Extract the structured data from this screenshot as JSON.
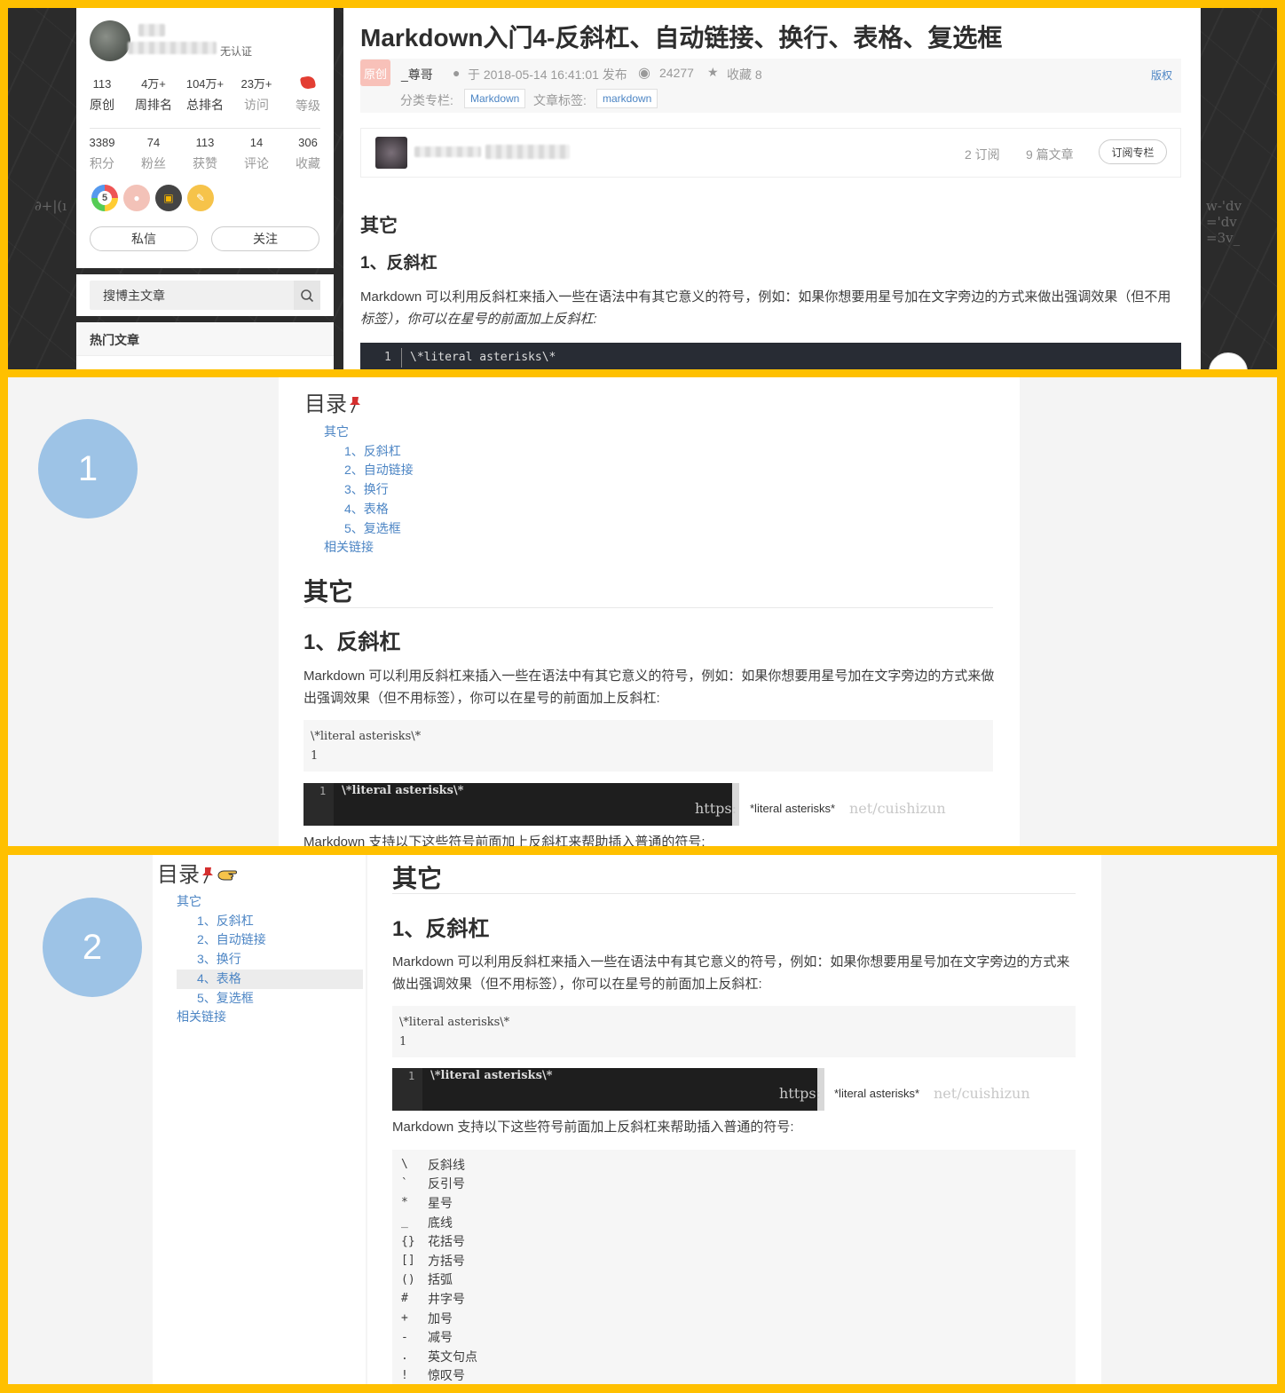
{
  "panel1": {
    "profile": {
      "auth": "无认证",
      "stats_top": [
        {
          "value": "113",
          "label": "原创"
        },
        {
          "value": "4万+",
          "label": "周排名"
        },
        {
          "value": "104万+",
          "label": "总排名"
        },
        {
          "value": "23万+",
          "label": "访问"
        },
        {
          "value": "",
          "label": "等级"
        }
      ],
      "stats_bottom": [
        {
          "value": "3389",
          "label": "积分"
        },
        {
          "value": "74",
          "label": "粉丝"
        },
        {
          "value": "113",
          "label": "获赞"
        },
        {
          "value": "14",
          "label": "评论"
        },
        {
          "value": "306",
          "label": "收藏"
        }
      ],
      "badge_five": "5",
      "message_button": "私信",
      "follow_button": "关注"
    },
    "search": {
      "placeholder": "搜博主文章"
    },
    "hot": {
      "title": "热门文章"
    },
    "article": {
      "title": "Markdown入门4-反斜杠、自动链接、换行、表格、复选框",
      "original_badge": "原创",
      "author": "_尊哥",
      "published": "于 2018-05-14 16:41:01 发布",
      "views": "24277",
      "favorites": "收藏 8",
      "copyright": "版权",
      "category_label": "分类专栏:",
      "category": "Markdown",
      "tags_label": "文章标签:",
      "tag": "markdown",
      "subscriptions": "2 订阅",
      "articles_count": "9 篇文章",
      "subscribe_button": "订阅专栏",
      "h2": "其它",
      "h3": "1、反斜杠",
      "para_before": "Markdown 可以利用反斜杠来插入一些在语法中有其它意义的符号，例如：如果你想要用星号加在文字旁边的方式来做出强调效果（但不用",
      "para_italic": "标签），你可以在星号的前面加上反斜杠:",
      "code_line_no": "1",
      "code_text": "\\*literal asterisks\\*"
    }
  },
  "panel2": {
    "number": "1",
    "toc_title": "目录",
    "toc": [
      {
        "label": "其它",
        "level": 1
      },
      {
        "label": "1、反斜杠",
        "level": 2
      },
      {
        "label": "2、自动链接",
        "level": 2
      },
      {
        "label": "3、换行",
        "level": 2
      },
      {
        "label": "4、表格",
        "level": 2
      },
      {
        "label": "5、复选框",
        "level": 2
      },
      {
        "label": "相关链接",
        "level": 1
      }
    ],
    "h2": "其它",
    "h3": "1、反斜杠",
    "para": "Markdown 可以利用反斜杠来插入一些在语法中有其它意义的符号，例如：如果你想要用星号加在文字旁边的方式来做出强调效果（但不用标签），你可以在星号的前面加上反斜杠:",
    "code_text": "\\*literal asterisks\\*",
    "code_line_no": "1",
    "shot_line_no": "1",
    "shot_text": "\\*literal asterisks\\*",
    "watermark_left": "https:",
    "rendered": "*literal asterisks*",
    "watermark_right": "net/cuishizun",
    "tail": "Markdown 支持以下这些符号前面加上反斜杠来帮助插入普通的符号:"
  },
  "panel3": {
    "number": "2",
    "toc_title": "目录",
    "toc": [
      {
        "label": "其它",
        "level": 1
      },
      {
        "label": "1、反斜杠",
        "level": 2
      },
      {
        "label": "2、自动链接",
        "level": 2
      },
      {
        "label": "3、换行",
        "level": 2
      },
      {
        "label": "4、表格",
        "level": 2,
        "highlight": true
      },
      {
        "label": "5、复选框",
        "level": 2
      },
      {
        "label": "相关链接",
        "level": 1
      }
    ],
    "h2": "其它",
    "h3": "1、反斜杠",
    "para": "Markdown 可以利用反斜杠来插入一些在语法中有其它意义的符号，例如：如果你想要用星号加在文字旁边的方式来做出强调效果（但不用标签），你可以在星号的前面加上反斜杠:",
    "code_text": "\\*literal asterisks\\*",
    "code_line_no": "1",
    "shot_line_no": "1",
    "shot_text": "\\*literal asterisks\\*",
    "watermark_left": "https:",
    "rendered": "*literal asterisks*",
    "watermark_right": "net/cuishizun",
    "tail": "Markdown 支持以下这些符号前面加上反斜杠来帮助插入普通的符号:",
    "escapes": [
      {
        "char": "\\",
        "name": "反斜线"
      },
      {
        "char": "`",
        "name": "反引号"
      },
      {
        "char": "*",
        "name": "星号"
      },
      {
        "char": "_",
        "name": "底线"
      },
      {
        "char": "{}",
        "name": "花括号"
      },
      {
        "char": "[]",
        "name": "方括号"
      },
      {
        "char": "()",
        "name": "括弧"
      },
      {
        "char": "#",
        "name": "井字号"
      },
      {
        "char": "+",
        "name": "加号"
      },
      {
        "char": "-",
        "name": "减号"
      },
      {
        "char": ".",
        "name": "英文句点"
      },
      {
        "char": "!",
        "name": "惊叹号"
      }
    ]
  },
  "colors": {
    "frame": "#FFC000",
    "link": "#4c85c4",
    "circle": "#9DC3E6",
    "original_badge": "#f8c1b9"
  }
}
